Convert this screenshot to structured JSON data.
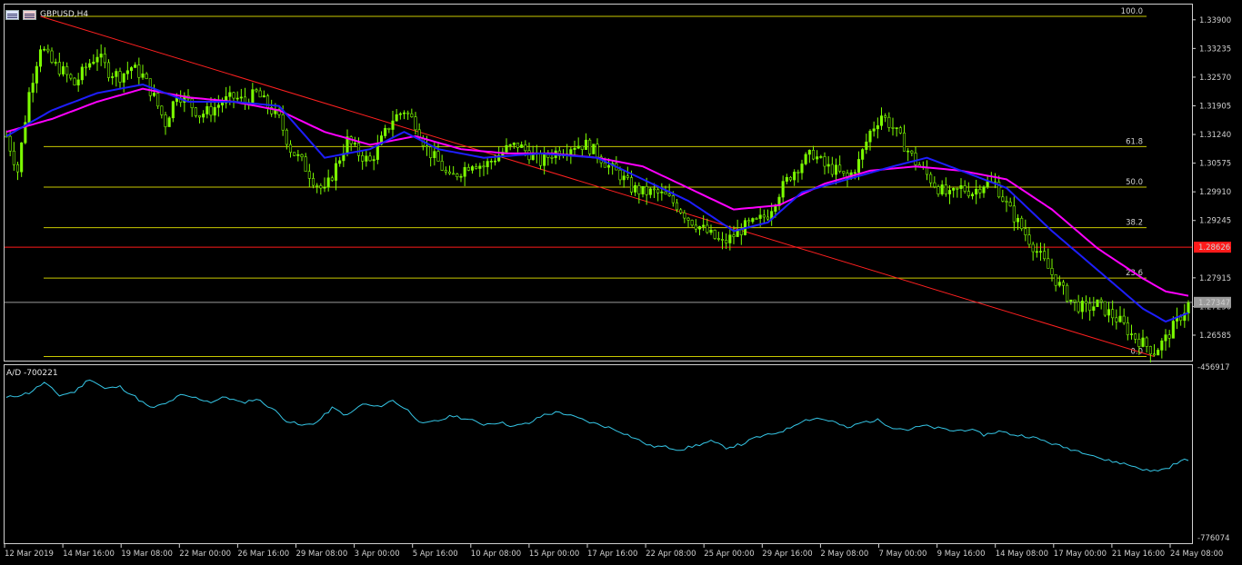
{
  "window": {
    "symbol_label": "GBPUSD,H4",
    "indicator_label": "A/D -700221"
  },
  "icons": [
    "chart-window-icon",
    "chart-window-icon-secondary"
  ],
  "colors": {
    "background": "#000000",
    "bull_candle": "#7CFC00",
    "ma_fast": "#1E1EFF",
    "ma_slow": "#FF00FF",
    "fibo": "#C8C800",
    "trendline": "#FF2020",
    "price_level": "#FF1A1A",
    "ad_line": "#35C6E6",
    "current_price_line": "#9A9A9A"
  },
  "chart_data": [
    {
      "type": "candlestick",
      "symbol": "GBPUSD",
      "timeframe": "H4",
      "y_ticks": [
        "1.33900",
        "1.33235",
        "1.32570",
        "1.31905",
        "1.31240",
        "1.30575",
        "1.29910",
        "1.29245",
        "1.27915",
        "1.27250",
        "1.26585"
      ],
      "ylim": [
        1.261,
        1.3398
      ],
      "x_ticks": [
        "12 Mar 2019",
        "14 Mar 16:00",
        "19 Mar 08:00",
        "22 Mar 00:00",
        "26 Mar 16:00",
        "29 Mar 08:00",
        "3 Apr 00:00",
        "5 Apr 16:00",
        "10 Apr 08:00",
        "15 Apr 00:00",
        "17 Apr 16:00",
        "22 Apr 08:00",
        "25 Apr 00:00",
        "29 Apr 16:00",
        "2 May 08:00",
        "7 May 00:00",
        "9 May 16:00",
        "14 May 08:00",
        "17 May 00:00",
        "21 May 16:00",
        "24 May 08:00"
      ],
      "close_path": [
        [
          0,
          1.312
        ],
        [
          3,
          1.304
        ],
        [
          6,
          1.322
        ],
        [
          9,
          1.333
        ],
        [
          12,
          1.329
        ],
        [
          15,
          1.327
        ],
        [
          18,
          1.324
        ],
        [
          21,
          1.328
        ],
        [
          24,
          1.331
        ],
        [
          27,
          1.327
        ],
        [
          30,
          1.326
        ],
        [
          33,
          1.328
        ],
        [
          36,
          1.326
        ],
        [
          39,
          1.321
        ],
        [
          42,
          1.315
        ],
        [
          45,
          1.322
        ],
        [
          48,
          1.32
        ],
        [
          51,
          1.317
        ],
        [
          54,
          1.318
        ],
        [
          57,
          1.32
        ],
        [
          60,
          1.321
        ],
        [
          63,
          1.32
        ],
        [
          66,
          1.322
        ],
        [
          69,
          1.319
        ],
        [
          72,
          1.316
        ],
        [
          75,
          1.309
        ],
        [
          78,
          1.306
        ],
        [
          81,
          1.302
        ],
        [
          84,
          1.299
        ],
        [
          87,
          1.305
        ],
        [
          90,
          1.311
        ],
        [
          93,
          1.308
        ],
        [
          96,
          1.306
        ],
        [
          99,
          1.311
        ],
        [
          102,
          1.316
        ],
        [
          105,
          1.318
        ],
        [
          108,
          1.315
        ],
        [
          111,
          1.309
        ],
        [
          114,
          1.306
        ],
        [
          117,
          1.302
        ],
        [
          120,
          1.304
        ],
        [
          123,
          1.306
        ],
        [
          126,
          1.305
        ],
        [
          129,
          1.307
        ],
        [
          132,
          1.309
        ],
        [
          135,
          1.31
        ],
        [
          138,
          1.308
        ],
        [
          141,
          1.306
        ],
        [
          144,
          1.308
        ],
        [
          147,
          1.309
        ],
        [
          150,
          1.31
        ],
        [
          153,
          1.31
        ],
        [
          156,
          1.308
        ],
        [
          159,
          1.305
        ],
        [
          162,
          1.303
        ],
        [
          165,
          1.3
        ],
        [
          168,
          1.299
        ],
        [
          171,
          1.299
        ],
        [
          174,
          1.298
        ],
        [
          177,
          1.296
        ],
        [
          180,
          1.293
        ],
        [
          183,
          1.291
        ],
        [
          186,
          1.289
        ],
        [
          189,
          1.287
        ],
        [
          192,
          1.289
        ],
        [
          195,
          1.291
        ],
        [
          198,
          1.292
        ],
        [
          201,
          1.294
        ],
        [
          204,
          1.299
        ],
        [
          207,
          1.303
        ],
        [
          210,
          1.306
        ],
        [
          213,
          1.308
        ],
        [
          216,
          1.305
        ],
        [
          219,
          1.304
        ],
        [
          222,
          1.302
        ],
        [
          225,
          1.306
        ],
        [
          228,
          1.313
        ],
        [
          231,
          1.317
        ],
        [
          234,
          1.314
        ],
        [
          237,
          1.31
        ],
        [
          240,
          1.306
        ],
        [
          243,
          1.303
        ],
        [
          246,
          1.3
        ],
        [
          249,
          1.298
        ],
        [
          252,
          1.3
        ],
        [
          255,
          1.299
        ],
        [
          258,
          1.301
        ],
        [
          261,
          1.301
        ],
        [
          264,
          1.296
        ],
        [
          267,
          1.292
        ],
        [
          270,
          1.288
        ],
        [
          273,
          1.284
        ],
        [
          276,
          1.28
        ],
        [
          279,
          1.276
        ],
        [
          282,
          1.273
        ],
        [
          285,
          1.272
        ],
        [
          288,
          1.273
        ],
        [
          291,
          1.271
        ],
        [
          294,
          1.269
        ],
        [
          297,
          1.266
        ],
        [
          300,
          1.264
        ],
        [
          303,
          1.262
        ],
        [
          306,
          1.265
        ],
        [
          309,
          1.269
        ],
        [
          312,
          1.273
        ]
      ],
      "ma_fast_path": [
        [
          0,
          1.312
        ],
        [
          12,
          1.318
        ],
        [
          24,
          1.322
        ],
        [
          36,
          1.324
        ],
        [
          48,
          1.32
        ],
        [
          60,
          1.32
        ],
        [
          72,
          1.319
        ],
        [
          84,
          1.307
        ],
        [
          96,
          1.309
        ],
        [
          105,
          1.313
        ],
        [
          114,
          1.309
        ],
        [
          126,
          1.307
        ],
        [
          141,
          1.308
        ],
        [
          156,
          1.307
        ],
        [
          168,
          1.302
        ],
        [
          180,
          1.297
        ],
        [
          192,
          1.29
        ],
        [
          201,
          1.292
        ],
        [
          210,
          1.299
        ],
        [
          222,
          1.302
        ],
        [
          234,
          1.305
        ],
        [
          243,
          1.307
        ],
        [
          252,
          1.304
        ],
        [
          264,
          1.3
        ],
        [
          276,
          1.29
        ],
        [
          288,
          1.281
        ],
        [
          300,
          1.272
        ],
        [
          306,
          1.269
        ],
        [
          312,
          1.271
        ]
      ],
      "ma_slow_path": [
        [
          0,
          1.313
        ],
        [
          12,
          1.316
        ],
        [
          24,
          1.32
        ],
        [
          36,
          1.323
        ],
        [
          48,
          1.321
        ],
        [
          60,
          1.32
        ],
        [
          72,
          1.318
        ],
        [
          84,
          1.313
        ],
        [
          96,
          1.31
        ],
        [
          108,
          1.312
        ],
        [
          120,
          1.309
        ],
        [
          132,
          1.308
        ],
        [
          144,
          1.308
        ],
        [
          156,
          1.307
        ],
        [
          168,
          1.305
        ],
        [
          180,
          1.3
        ],
        [
          192,
          1.295
        ],
        [
          204,
          1.296
        ],
        [
          216,
          1.301
        ],
        [
          228,
          1.304
        ],
        [
          240,
          1.305
        ],
        [
          252,
          1.304
        ],
        [
          264,
          1.302
        ],
        [
          276,
          1.295
        ],
        [
          288,
          1.286
        ],
        [
          300,
          1.279
        ],
        [
          306,
          1.276
        ],
        [
          312,
          1.275
        ]
      ],
      "fibonacci": {
        "levels": [
          "100.0",
          "61.8",
          "50.0",
          "38.2",
          "23.6",
          "0.0"
        ],
        "prices": [
          1.3398,
          1.3096,
          1.3002,
          1.2908,
          1.2791,
          1.2609
        ]
      },
      "trendline": [
        [
          9,
          1.3398
        ],
        [
          303,
          1.2609
        ]
      ],
      "price_level": {
        "label": "1.28626",
        "price": 1.28626
      },
      "current_price": {
        "label": "1.27347",
        "price": 1.27347
      }
    },
    {
      "type": "line",
      "indicator": "A/D",
      "current_value": "-700221",
      "y_ticks": [
        "-456917",
        "-776074"
      ],
      "ylim": [
        -776074,
        -456917
      ],
      "path": [
        [
          0,
          -500000
        ],
        [
          6,
          -490000
        ],
        [
          10,
          -470000
        ],
        [
          14,
          -495000
        ],
        [
          18,
          -488000
        ],
        [
          22,
          -462000
        ],
        [
          26,
          -482000
        ],
        [
          30,
          -478000
        ],
        [
          34,
          -498000
        ],
        [
          38,
          -520000
        ],
        [
          42,
          -512000
        ],
        [
          46,
          -495000
        ],
        [
          50,
          -500000
        ],
        [
          54,
          -508000
        ],
        [
          58,
          -498000
        ],
        [
          62,
          -510000
        ],
        [
          66,
          -502000
        ],
        [
          70,
          -520000
        ],
        [
          74,
          -545000
        ],
        [
          78,
          -555000
        ],
        [
          82,
          -548000
        ],
        [
          86,
          -520000
        ],
        [
          90,
          -535000
        ],
        [
          94,
          -512000
        ],
        [
          98,
          -518000
        ],
        [
          102,
          -505000
        ],
        [
          106,
          -525000
        ],
        [
          110,
          -552000
        ],
        [
          114,
          -545000
        ],
        [
          118,
          -535000
        ],
        [
          122,
          -543000
        ],
        [
          126,
          -552000
        ],
        [
          130,
          -548000
        ],
        [
          134,
          -556000
        ],
        [
          138,
          -550000
        ],
        [
          142,
          -533000
        ],
        [
          146,
          -528000
        ],
        [
          150,
          -538000
        ],
        [
          154,
          -548000
        ],
        [
          158,
          -556000
        ],
        [
          162,
          -566000
        ],
        [
          166,
          -580000
        ],
        [
          170,
          -595000
        ],
        [
          174,
          -597000
        ],
        [
          178,
          -602000
        ],
        [
          182,
          -594000
        ],
        [
          186,
          -586000
        ],
        [
          190,
          -598000
        ],
        [
          194,
          -592000
        ],
        [
          198,
          -578000
        ],
        [
          202,
          -572000
        ],
        [
          206,
          -562000
        ],
        [
          210,
          -545000
        ],
        [
          214,
          -540000
        ],
        [
          218,
          -546000
        ],
        [
          222,
          -560000
        ],
        [
          226,
          -548000
        ],
        [
          230,
          -544000
        ],
        [
          234,
          -558000
        ],
        [
          238,
          -563000
        ],
        [
          242,
          -555000
        ],
        [
          246,
          -560000
        ],
        [
          250,
          -565000
        ],
        [
          254,
          -562000
        ],
        [
          258,
          -573000
        ],
        [
          262,
          -566000
        ],
        [
          266,
          -573000
        ],
        [
          270,
          -576000
        ],
        [
          274,
          -585000
        ],
        [
          278,
          -595000
        ],
        [
          282,
          -603000
        ],
        [
          286,
          -610000
        ],
        [
          290,
          -623000
        ],
        [
          294,
          -628000
        ],
        [
          298,
          -636000
        ],
        [
          302,
          -645000
        ],
        [
          306,
          -640000
        ],
        [
          310,
          -625000
        ],
        [
          312,
          -621000
        ]
      ]
    }
  ]
}
